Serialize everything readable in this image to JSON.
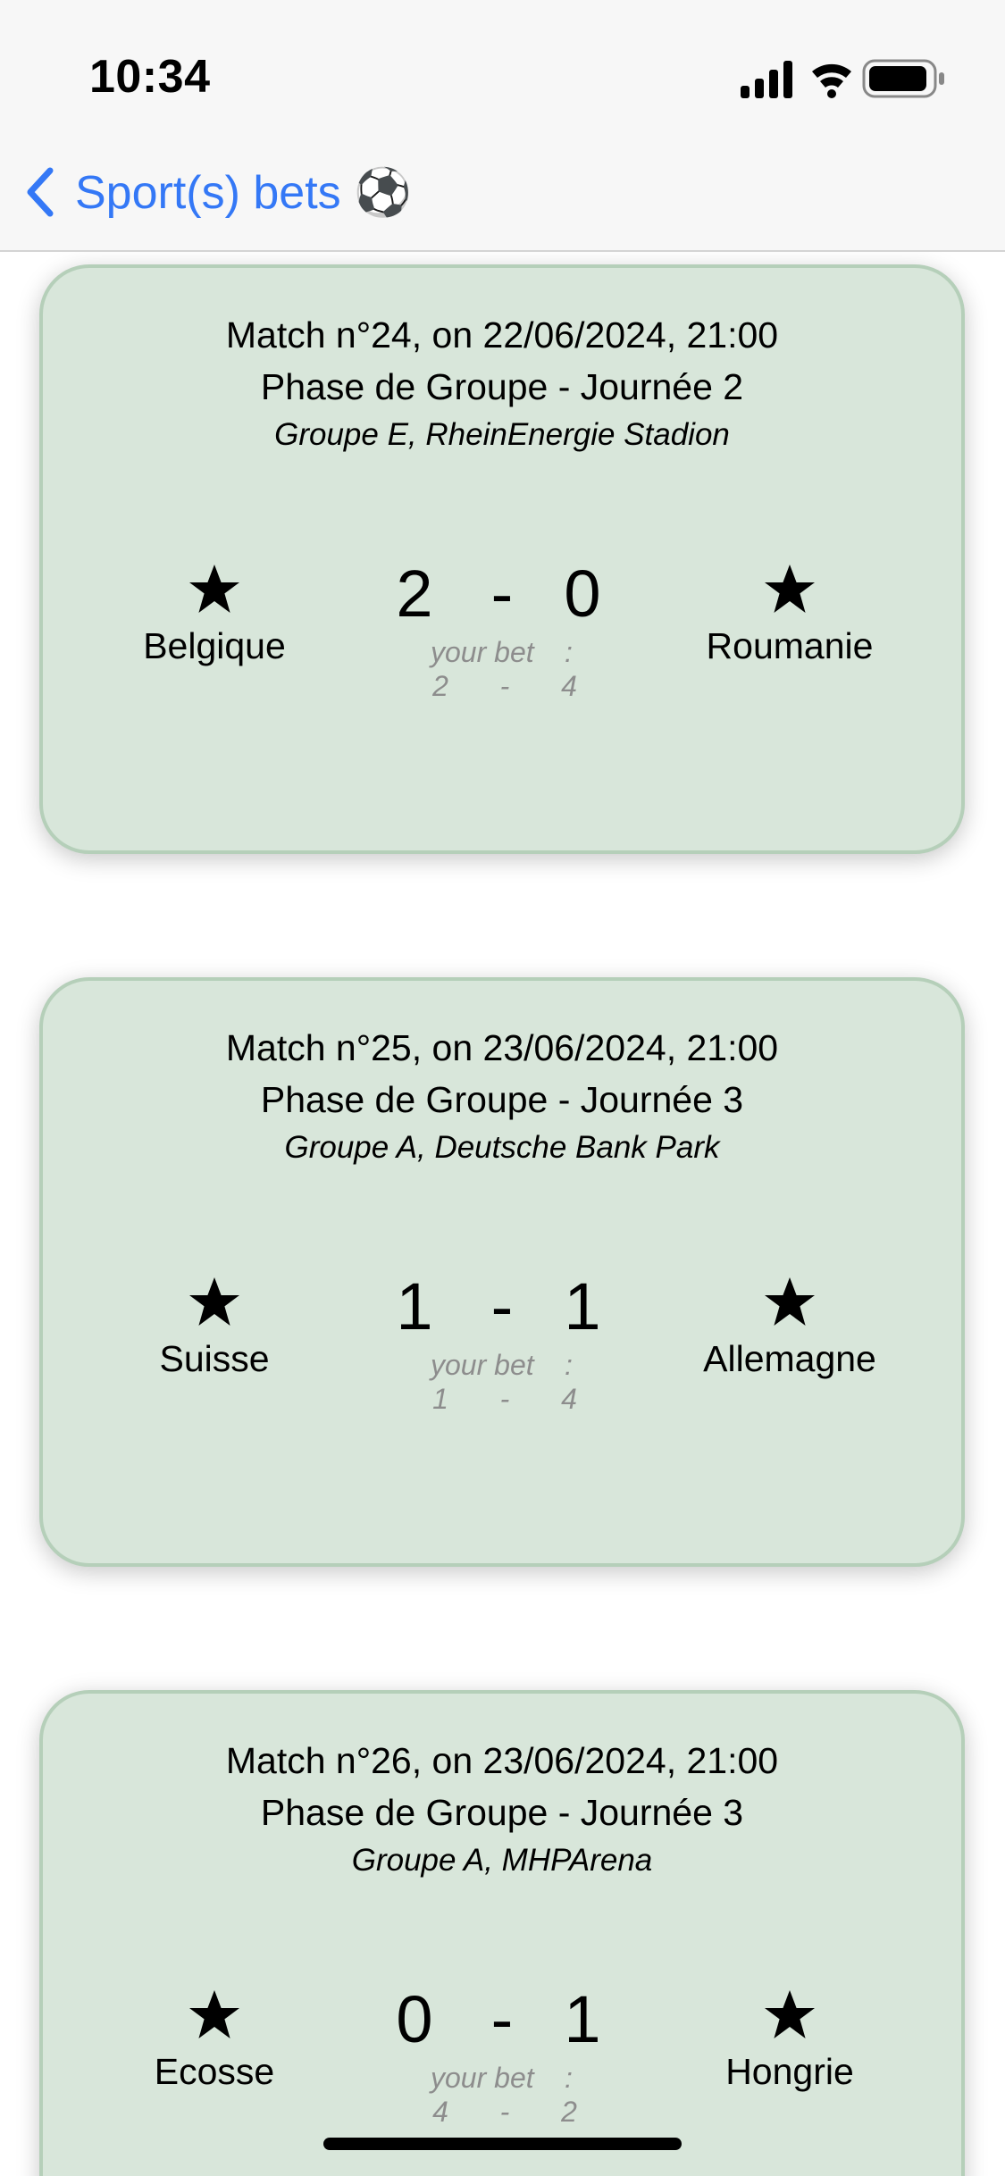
{
  "status_bar": {
    "time": "10:34",
    "icons": [
      "cellular-signal-icon",
      "wifi-icon",
      "battery-icon"
    ]
  },
  "nav": {
    "back_label": "Sport(s) bets ⚽️",
    "back_icon": "chevron-left-icon",
    "accent_color": "#3478f6"
  },
  "card_style": {
    "background": "#d8e6da",
    "border": "#b5cfb9"
  },
  "matches": [
    {
      "line1": "Match n°24, on 22/06/2024, 21:00",
      "line2": "Phase de Groupe - Journée 2",
      "line3": "Groupe E, RheinEnergie Stadion",
      "home_team": "Belgique",
      "away_team": "Roumanie",
      "score_home": "2",
      "score_sep": "-",
      "score_away": "0",
      "bet_label": "your bet",
      "bet_colon": ":",
      "bet_home": "2",
      "bet_sep": "-",
      "bet_away": "4"
    },
    {
      "line1": "Match n°25, on 23/06/2024, 21:00",
      "line2": "Phase de Groupe - Journée 3",
      "line3": "Groupe A, Deutsche Bank Park",
      "home_team": "Suisse",
      "away_team": "Allemagne",
      "score_home": "1",
      "score_sep": "-",
      "score_away": "1",
      "bet_label": "your bet",
      "bet_colon": ":",
      "bet_home": "1",
      "bet_sep": "-",
      "bet_away": "4"
    },
    {
      "line1": "Match n°26, on 23/06/2024, 21:00",
      "line2": "Phase de Groupe - Journée 3",
      "line3": "Groupe A, MHPArena",
      "home_team": "Ecosse",
      "away_team": "Hongrie",
      "score_home": "0",
      "score_sep": "-",
      "score_away": "1",
      "bet_label": "your bet",
      "bet_colon": ":",
      "bet_home": "4",
      "bet_sep": "-",
      "bet_away": "2"
    }
  ]
}
